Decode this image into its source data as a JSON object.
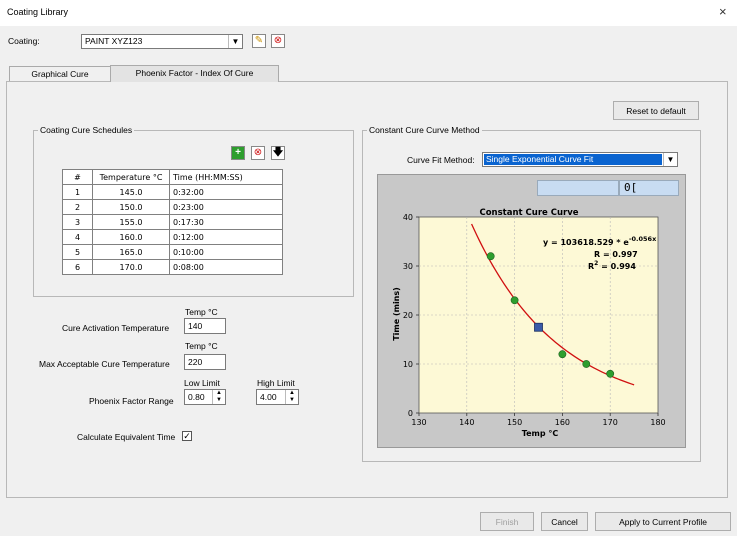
{
  "window": {
    "title": "Coating Library",
    "close": "×"
  },
  "coating": {
    "label": "Coating:",
    "value": "PAINT XYZ123"
  },
  "tabs": [
    {
      "label": "Graphical Cure"
    },
    {
      "label": "Phoenix Factor - Index Of Cure"
    }
  ],
  "reset_label": "Reset to default",
  "schedules": {
    "title": "Coating Cure Schedules",
    "columns": [
      "#",
      "Temperature °C",
      "Time (HH:MM:SS)"
    ],
    "rows": [
      [
        "1",
        "145.0",
        "0:32:00"
      ],
      [
        "2",
        "150.0",
        "0:23:00"
      ],
      [
        "3",
        "155.0",
        "0:17:30"
      ],
      [
        "4",
        "160.0",
        "0:12:00"
      ],
      [
        "5",
        "165.0",
        "0:10:00"
      ],
      [
        "6",
        "170.0",
        "0:08:00"
      ]
    ]
  },
  "params": {
    "temp_unit": "Temp °C",
    "activation_label": "Cure Activation Temperature",
    "activation_value": "140",
    "max_label": "Max Acceptable Cure Temperature",
    "max_value": "220",
    "low_limit_label": "Low Limit",
    "high_limit_label": "High Limit",
    "range_label": "Phoenix Factor Range",
    "low_value": "0.80",
    "high_value": "4.00",
    "equiv_label": "Calculate Equivalent Time",
    "equiv_checked": "✓"
  },
  "method": {
    "title": "Constant Cure Curve Method",
    "fit_label": "Curve Fit Method:",
    "fit_value": "Single Exponential Curve Fit"
  },
  "chart_data": {
    "type": "scatter",
    "title": "Constant Cure Curve",
    "xlabel": "Temp °C",
    "ylabel": "Time (mins)",
    "xlim": [
      130,
      180
    ],
    "ylim": [
      0,
      40
    ],
    "xticks": [
      130,
      140,
      150,
      160,
      170,
      180
    ],
    "yticks": [
      0,
      10,
      20,
      30,
      40
    ],
    "points_x": [
      145,
      150,
      160,
      165,
      170
    ],
    "points_y": [
      32,
      23,
      12,
      10,
      8
    ],
    "marker_x": 155,
    "marker_y": 17.5,
    "fit_a": 103618.529,
    "fit_b": -0.056,
    "fit_range": [
      141,
      175
    ],
    "equation": "y = 103618.529 * e",
    "equation_exp": "-0.056x",
    "r_text": "R = 0.997",
    "r2_prefix": "R",
    "r2_sup": "2",
    "r2_suffix": " = 0.994",
    "readout": "0[",
    "colors": {
      "curve": "#d01010",
      "points": "#2e9e2e",
      "marker": "#3a5aa8",
      "plot_bg": "#fdf9d6"
    }
  },
  "footer": {
    "finish": "Finish",
    "cancel": "Cancel",
    "apply": "Apply to Current Profile"
  }
}
